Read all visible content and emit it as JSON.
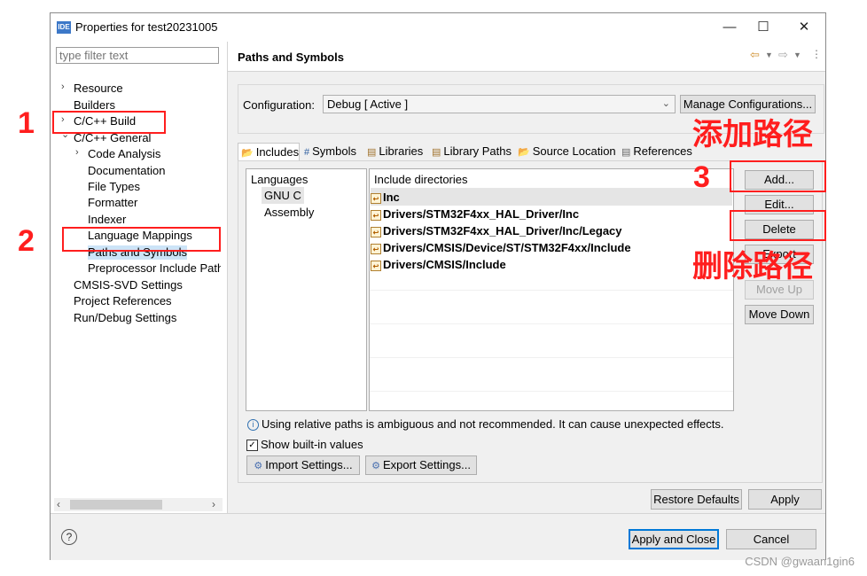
{
  "window": {
    "title": "Properties for test20231005",
    "icon_text": "IDE",
    "minimize_icon": "minimize-icon",
    "maximize_icon": "maximize-icon",
    "close_icon": "close-icon"
  },
  "sidebar": {
    "filter_placeholder": "type filter text",
    "items": [
      {
        "label": "Resource",
        "arrow": "›"
      },
      {
        "label": "Builders",
        "arrow": ""
      },
      {
        "label": "C/C++ Build",
        "arrow": "›"
      },
      {
        "label": "C/C++ General",
        "arrow": "⌄"
      },
      {
        "label": "Code Analysis",
        "arrow": "›"
      },
      {
        "label": "Documentation",
        "arrow": ""
      },
      {
        "label": "File Types",
        "arrow": ""
      },
      {
        "label": "Formatter",
        "arrow": ""
      },
      {
        "label": "Indexer",
        "arrow": ""
      },
      {
        "label": "Language Mappings",
        "arrow": ""
      },
      {
        "label": "Paths and Symbols",
        "arrow": ""
      },
      {
        "label": "Preprocessor Include Path",
        "arrow": ""
      },
      {
        "label": "CMSIS-SVD Settings",
        "arrow": ""
      },
      {
        "label": "Project References",
        "arrow": ""
      },
      {
        "label": "Run/Debug Settings",
        "arrow": ""
      }
    ]
  },
  "page": {
    "title": "Paths and Symbols",
    "configuration_label": "Configuration:",
    "configuration_value": "Debug  [ Active ]",
    "manage_configurations": "Manage Configurations...",
    "tabs": [
      {
        "label": "Includes",
        "icon": "includes-icon"
      },
      {
        "label": "Symbols",
        "icon": "hash-icon"
      },
      {
        "label": "Libraries",
        "icon": "libraries-icon"
      },
      {
        "label": "Library Paths",
        "icon": "library-paths-icon"
      },
      {
        "label": "Source Location",
        "icon": "source-location-icon"
      },
      {
        "label": "References",
        "icon": "references-icon"
      }
    ],
    "languages_header": "Languages",
    "languages": [
      "GNU C",
      "Assembly"
    ],
    "include_header": "Include directories",
    "include_dirs": [
      "Inc",
      "Drivers/STM32F4xx_HAL_Driver/Inc",
      "Drivers/STM32F4xx_HAL_Driver/Inc/Legacy",
      "Drivers/CMSIS/Device/ST/STM32F4xx/Include",
      "Drivers/CMSIS/Include"
    ],
    "buttons": {
      "add": "Add...",
      "edit": "Edit...",
      "delete": "Delete",
      "export": "Export",
      "move_up": "Move Up",
      "move_down": "Move Down"
    },
    "info_text": "Using relative paths is ambiguous and not recommended. It can cause unexpected effects.",
    "show_builtin_label": "Show built-in values",
    "show_builtin_checked": true,
    "import_settings": "Import Settings...",
    "export_settings": "Export Settings...",
    "restore_defaults": "Restore Defaults",
    "apply": "Apply"
  },
  "footer": {
    "help_icon": "help-icon",
    "apply_and_close": "Apply and Close",
    "cancel": "Cancel"
  },
  "annotations": {
    "num1": "1",
    "num2": "2",
    "num3": "3",
    "add_path_cn": "添加路径",
    "delete_path_cn": "删除路径",
    "color": "#ff1e1e"
  },
  "watermark": "CSDN @gwaan1gin6"
}
